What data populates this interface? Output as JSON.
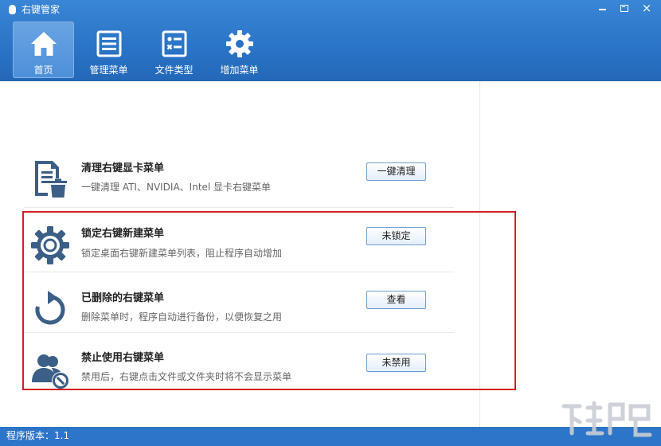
{
  "window": {
    "title": "右键管家",
    "controls": {
      "minimize": "minimize",
      "restore": "restore",
      "close": "×"
    }
  },
  "nav": {
    "items": [
      {
        "label": "首页",
        "icon": "home-icon",
        "active": true
      },
      {
        "label": "管理菜单",
        "icon": "menu-list-icon",
        "active": false
      },
      {
        "label": "文件类型",
        "icon": "file-type-icon",
        "active": false
      },
      {
        "label": "增加菜单",
        "icon": "gear-icon",
        "active": false
      }
    ]
  },
  "rows": [
    {
      "title": "清理右键显卡菜单",
      "desc": "一键清理 ATI、NVIDIA、Intel 显卡右键菜单",
      "button": "一键清理",
      "icon": "document-trash-icon"
    },
    {
      "title": "锁定右键新建菜单",
      "desc": "锁定桌面右键新建菜单列表，阻止程序自动增加",
      "button": "未锁定",
      "icon": "gear-icon"
    },
    {
      "title": "已删除的右键菜单",
      "desc": "删除菜单时，程序自动进行备份，以便恢复之用",
      "button": "查看",
      "icon": "refresh-icon"
    },
    {
      "title": "禁止使用右键菜单",
      "desc": "禁用后，右键点击文件或文件夹时将不会显示菜单",
      "button": "未禁用",
      "icon": "user-block-icon"
    }
  ],
  "status": {
    "version": "程序版本：1.1"
  },
  "colors": {
    "header": "#2a73c6",
    "icon": "#3b5f86",
    "highlight": "#d01f26"
  }
}
